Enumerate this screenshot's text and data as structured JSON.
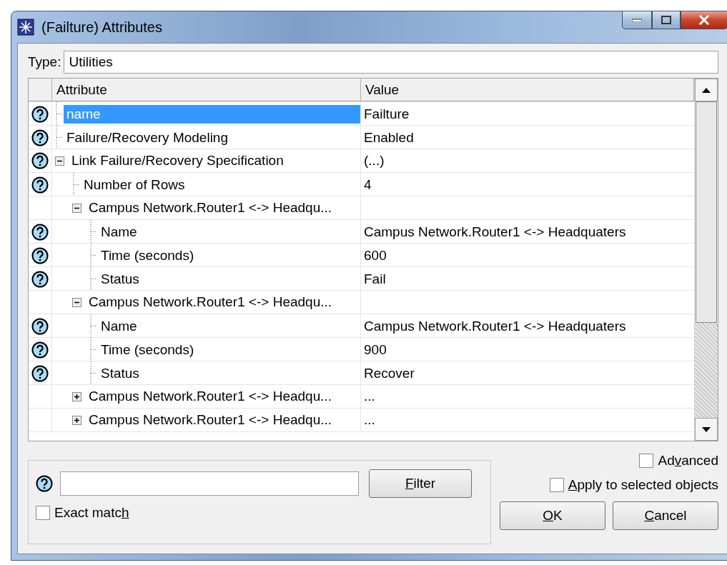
{
  "window": {
    "title": "(Failture) Attributes"
  },
  "type_field": {
    "label": "Type:",
    "value": "Utilities"
  },
  "table": {
    "columns": [
      "Attribute",
      "Value"
    ],
    "rows": [
      {
        "attribute": "name",
        "value": "Failture",
        "help": true,
        "selected": true
      },
      {
        "attribute": "Failure/Recovery Modeling",
        "value": "Enabled",
        "help": true,
        "selected": false
      },
      {
        "attribute": "Link Failure/Recovery Specification",
        "value": "(...)",
        "help": true,
        "selected": false,
        "expanded": true,
        "children": [
          {
            "attribute": "Number of Rows",
            "value": "4",
            "help": true,
            "selected": false
          },
          {
            "attribute": "Campus Network.Router1 <-> Headqu...",
            "help": false,
            "selected": false,
            "expanded": true,
            "children": [
              {
                "attribute": "Name",
                "value": "Campus Network.Router1 <-> Headquaters",
                "help": true,
                "selected": false
              },
              {
                "attribute": "Time (seconds)",
                "value": "600",
                "help": true,
                "selected": false
              },
              {
                "attribute": "Status",
                "value": "Fail",
                "help": true,
                "selected": false
              }
            ]
          },
          {
            "attribute": "Campus Network.Router1 <-> Headqu...",
            "help": false,
            "selected": false,
            "expanded": true,
            "children": [
              {
                "attribute": "Name",
                "value": "Campus Network.Router1 <-> Headquaters",
                "help": true,
                "selected": false
              },
              {
                "attribute": "Time (seconds)",
                "value": "900",
                "help": true,
                "selected": false
              },
              {
                "attribute": "Status",
                "value": "Recover",
                "help": true,
                "selected": false
              }
            ]
          },
          {
            "attribute": "Campus Network.Router1 <-> Headqu...",
            "value": "...",
            "help": false,
            "selected": false,
            "expanded": false
          },
          {
            "attribute": "Campus Network.Router1 <-> Headqu...",
            "value": "...",
            "help": false,
            "selected": false,
            "expanded": false
          }
        ]
      }
    ]
  },
  "filter": {
    "button": {
      "key": "F",
      "after": "ilter"
    },
    "exact_match": {
      "before": "Exact matc",
      "key": "h",
      "checked": false
    }
  },
  "advanced": {
    "before": "Ad",
    "key": "v",
    "after": "anced",
    "checked": false
  },
  "apply_selected": {
    "key": "A",
    "after": "pply to selected objects",
    "checked": false
  },
  "buttons": [
    {
      "key": "O",
      "after": "K"
    },
    {
      "key": "C",
      "after": "ancel"
    }
  ]
}
